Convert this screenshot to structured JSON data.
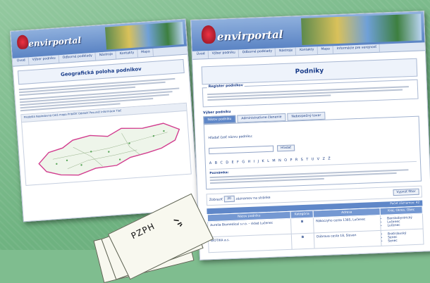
{
  "left_page": {
    "logo": "envirportal",
    "nav": [
      "Úvod",
      "Výber podniku",
      "Odborné podklady",
      "Nástroje",
      "Kontakty",
      "Mapa",
      "Informácie pre verejnosť"
    ],
    "title": "Geografická poloha podnikov",
    "toolbar": "Predošlá  Nasledovná  Celá mapa  Priblížiť  Oddialiť  Posunúť  Informácie  Tlač"
  },
  "right_page": {
    "logo": "envirportal",
    "nav": [
      "Úvod",
      "Výber podniku",
      "Odborné podklady",
      "Nástroje",
      "Kontakty",
      "Mapa",
      "Informácie pre verejnosť"
    ],
    "title": "Podniky",
    "intro_legend": "Register podnikov",
    "search_heading": "Výber podniku",
    "tabs": [
      "Názov podniku",
      "Administratívne členenie",
      "Nebezpečný tovar"
    ],
    "search_label": "Hľadať časť názvu podniku:",
    "search_button": "Hľadať",
    "alphabet": "A B C D E F G H I J K L M N O P R S T U V Z Ž",
    "note_title": "Poznámka:",
    "filter_label": "Zobraziť",
    "filter_value": "20",
    "filter_suffix": "záznamov na stránke",
    "filter_button": "Vypnúť filter",
    "table_top": "Počet záznamov: 42",
    "columns": [
      "Názov podniku",
      "Kategória",
      "Adresa",
      "Kraj, Okres, Obec"
    ],
    "rows": [
      {
        "name": "Aurelia Biomedical s.r.o. – sklad Lučenec",
        "cat": "B",
        "addr": "Rákoczyho cesta 1385, Lučenec",
        "region": [
          "Banskobystrický",
          "Lučenec",
          "Lučenec"
        ]
      },
      {
        "name": "BIOTIKA a.s.",
        "cat": "B",
        "addr": "Dúbrava cesta 18, Slovan",
        "region": [
          "Bratislavský",
          "Senec",
          "Senec"
        ]
      }
    ]
  },
  "stamp": "PZPH"
}
